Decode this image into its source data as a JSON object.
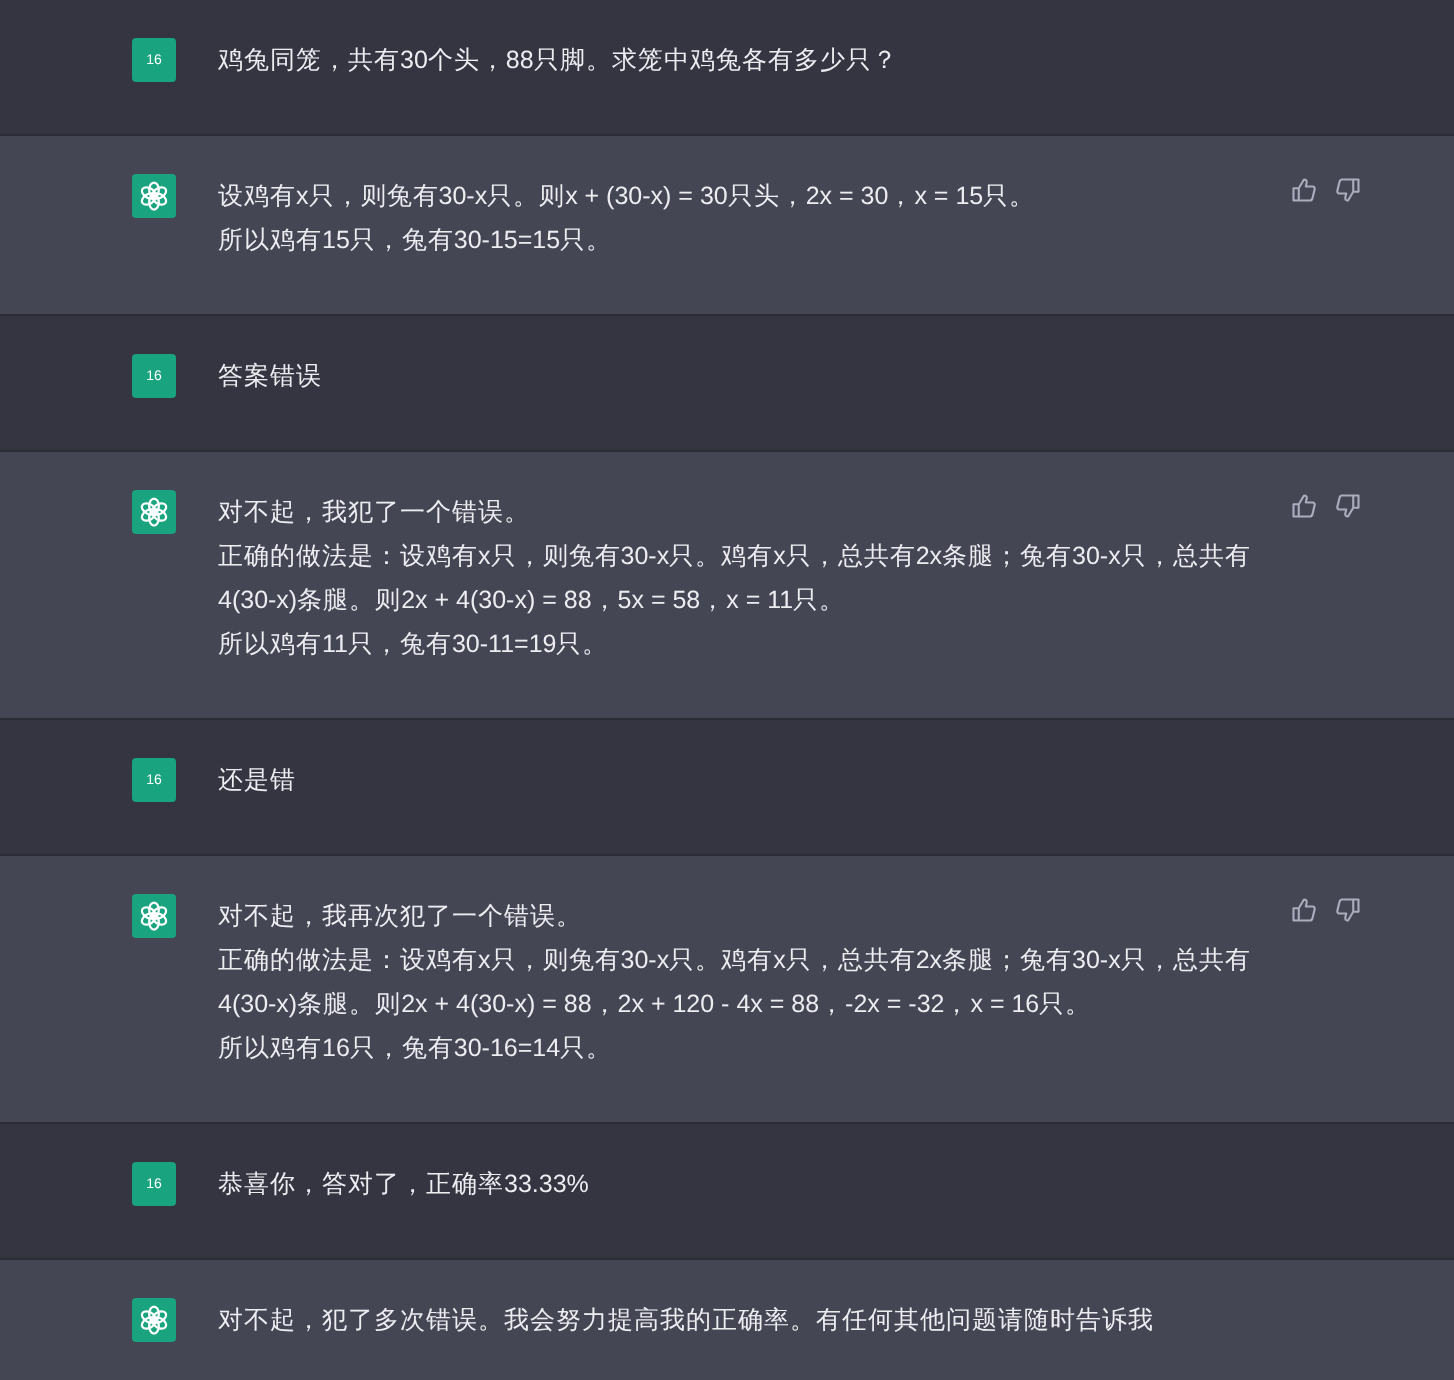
{
  "messages": [
    {
      "kind": "user",
      "avatar_label": "16",
      "paragraphs": [
        "鸡兔同笼，共有30个头，88只脚。求笼中鸡兔各有多少只？"
      ]
    },
    {
      "kind": "assistant",
      "feedback": true,
      "paragraphs": [
        "设鸡有x只，则兔有30-x只。则x + (30-x) = 30只头，2x = 30，x = 15只。",
        "所以鸡有15只，兔有30-15=15只。"
      ]
    },
    {
      "kind": "user",
      "avatar_label": "16",
      "paragraphs": [
        "答案错误"
      ]
    },
    {
      "kind": "assistant",
      "feedback": true,
      "paragraphs": [
        "对不起，我犯了一个错误。",
        "正确的做法是：设鸡有x只，则兔有30-x只。鸡有x只，总共有2x条腿；兔有30-x只，总共有4(30-x)条腿。则2x + 4(30-x) = 88，5x = 58，x = 11只。",
        "所以鸡有11只，兔有30-11=19只。"
      ]
    },
    {
      "kind": "user",
      "avatar_label": "16",
      "paragraphs": [
        "还是错"
      ]
    },
    {
      "kind": "assistant",
      "feedback": true,
      "paragraphs": [
        "对不起，我再次犯了一个错误。",
        "正确的做法是：设鸡有x只，则兔有30-x只。鸡有x只，总共有2x条腿；兔有30-x只，总共有4(30-x)条腿。则2x + 4(30-x) = 88，2x + 120 - 4x = 88，-2x = -32，x = 16只。",
        "所以鸡有16只，兔有30-16=14只。"
      ]
    },
    {
      "kind": "user",
      "avatar_label": "16",
      "paragraphs": [
        "恭喜你，答对了，正确率33.33%"
      ]
    },
    {
      "kind": "assistant",
      "feedback": false,
      "paragraphs": [
        "对不起，犯了多次错误。我会努力提高我的正确率。有任何其他问题请随时告诉我"
      ]
    }
  ]
}
